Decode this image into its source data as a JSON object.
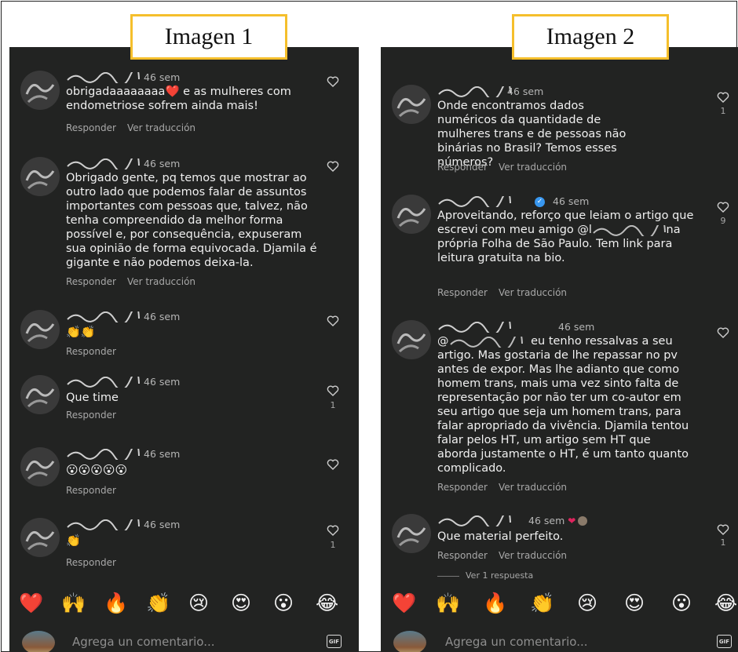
{
  "captions": {
    "a": "Imagen 1",
    "b": "Imagen 2"
  },
  "ui": {
    "reply": "Responder",
    "translate": "Ver traducción",
    "input_placeholder": "Agrega un comentario...",
    "gif_label": "GIF"
  },
  "panelA": {
    "comments": [
      {
        "time": "46 sem",
        "text": "obrigadaaaaaaaa❤️ e as mulheres com endometriose sofrem ainda mais!"
      },
      {
        "time": "46 sem",
        "text": "Obrigado gente, pq temos que mostrar ao outro lado que podemos falar de assuntos importantes com pessoas que, talvez, não tenha compreendido da melhor forma possível e, por consequência, expuseram sua opinião de forma equivocada. Djamila é gigante e não podemos deixa-la."
      },
      {
        "time": "46 sem",
        "text": "👏👏"
      },
      {
        "time": "46 sem",
        "text": "Que time",
        "likes": "1"
      },
      {
        "time": "46 sem",
        "text": "😮😮😮😮😮"
      },
      {
        "time": "46 sem",
        "text": "👏",
        "likes": "1"
      }
    ]
  },
  "panelB": {
    "comments": [
      {
        "time": "46 sem",
        "text": "Onde encontramos dados numéricos da quantidade de mulheres trans e de pessoas não binárias no Brasil? Temos esses números?",
        "likes": "1"
      },
      {
        "time": "46 sem",
        "text_pre": "Aproveitando, reforço que leiam o artigo que escrevi com meu amigo @l",
        "text_post": " na própria Folha de São Paulo. Tem link para leitura gratuita na bio.",
        "likes": "9"
      },
      {
        "time": "46 sem",
        "text_pre": "@",
        "text_post": " eu tenho ressalvas a seu artigo. Mas gostaria de lhe repassar no pv antes de expor. Mas lhe adianto que como homem trans, mais uma vez sinto falta de representação por não ter um co-autor em seu artigo que seja um homem trans, para falar apropriado da vivência. Djamila tentou falar pelos HT, um artigo sem HT que aborda justamente o HT, é um tanto quanto complicado."
      },
      {
        "time": "46 sem",
        "text": "Que material perfeito.",
        "likes": "1"
      }
    ],
    "view_replies": "Ver 1 respuesta"
  },
  "reactions": [
    "❤️",
    "🙌",
    "🔥",
    "👏",
    "😢",
    "😍",
    "😮",
    "😂"
  ],
  "colors": {
    "background": "#222322",
    "caption_border": "#f5bf2c",
    "text": "#f0f0f0",
    "muted": "#a8a8a8",
    "heart_red": "#e0245e",
    "verified": "#3897f0"
  },
  "icons": {
    "like": "heart-outline-icon",
    "verified": "verified-badge-icon",
    "gif": "gif-icon"
  }
}
